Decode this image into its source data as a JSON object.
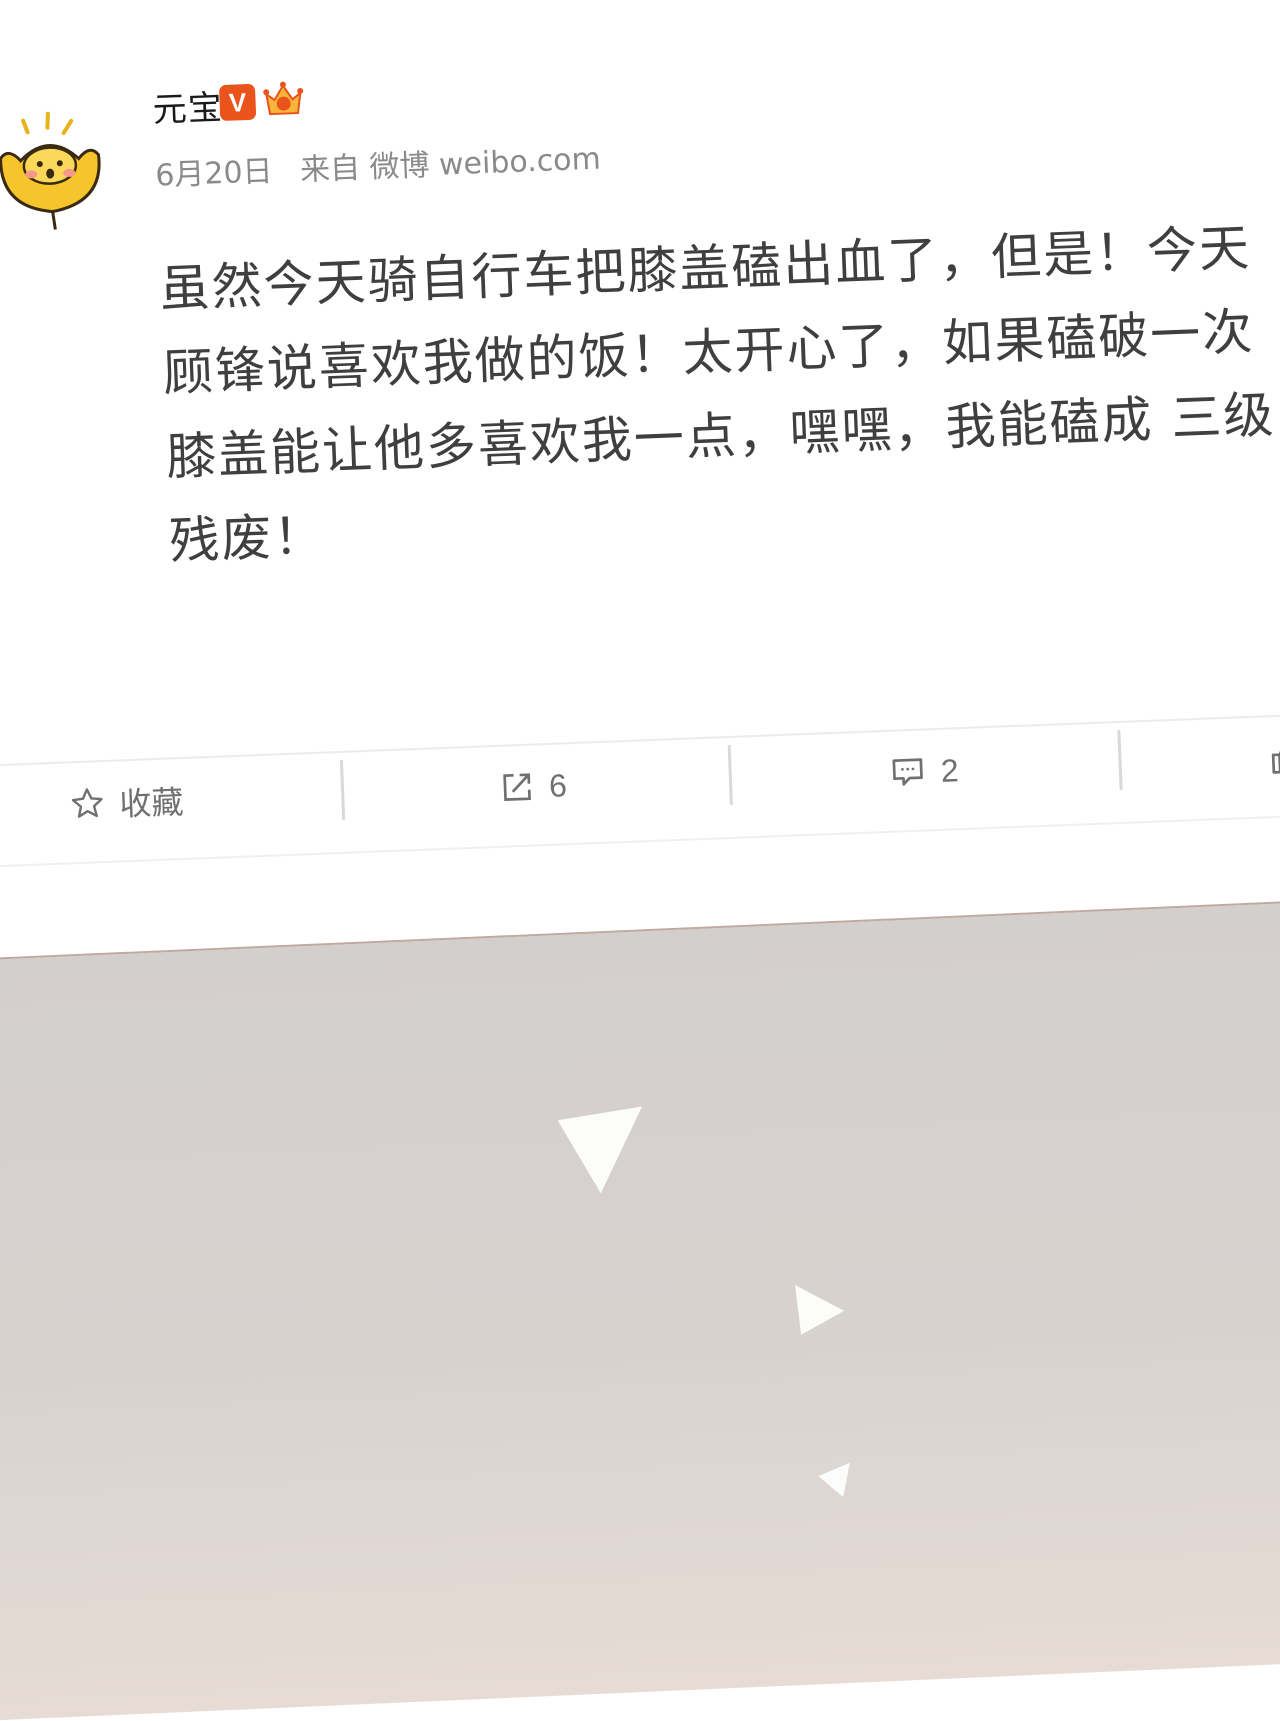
{
  "post": {
    "username": "元宝",
    "verified_badge": "V",
    "date": "6月20日",
    "source": "来自 微博 weibo.com",
    "content": "虽然今天骑自行车把膝盖磕出血了，但是！今天顾锋说喜欢我做的饭！太开心了，如果磕破一次膝盖能让他多喜欢我一点，嘿嘿，我能磕成 三级残废！"
  },
  "actions": {
    "favorite_label": "收藏",
    "repost_count": "6",
    "comment_count": "2"
  },
  "icons": {
    "avatar": "gold-ingot-avatar",
    "crown": "crown-badge-icon",
    "favorite": "star-icon",
    "repost": "share-icon",
    "comment": "comment-icon",
    "like": "thumbs-up-icon"
  },
  "colors": {
    "badge_orange": "#e8541c",
    "text_gray": "#707070",
    "background_lower": "#d3cfcd"
  }
}
